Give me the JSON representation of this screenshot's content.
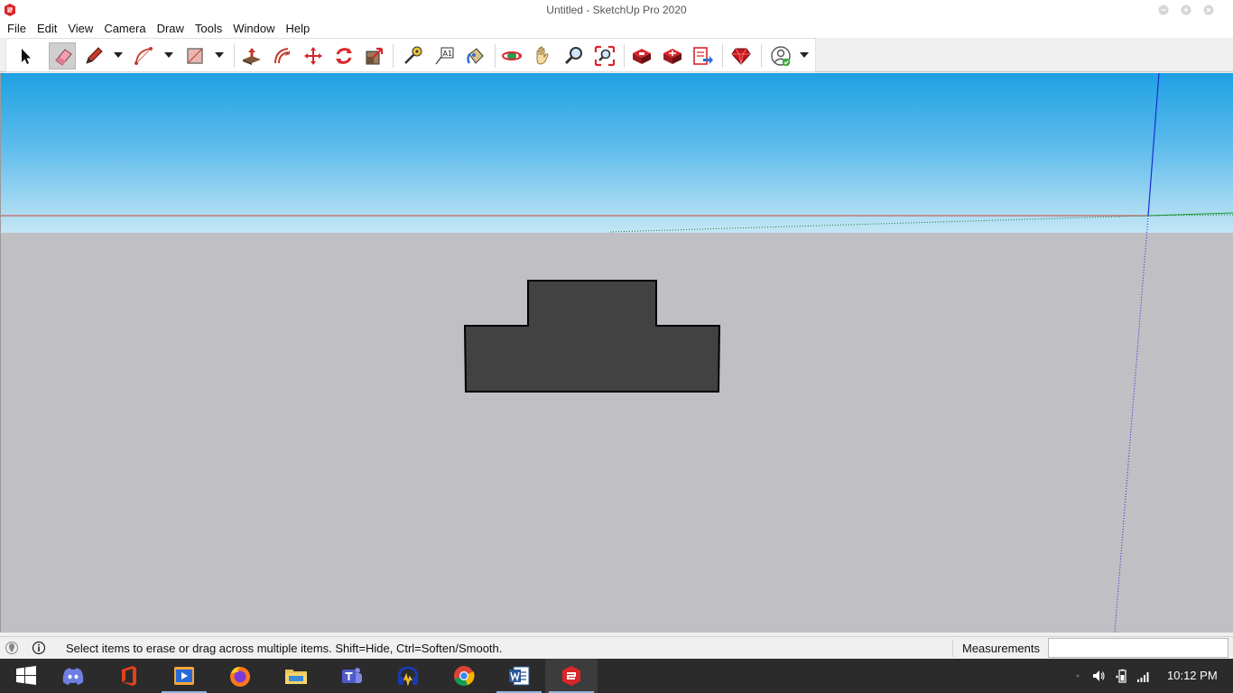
{
  "window": {
    "title": "Untitled - SketchUp Pro 2020",
    "app_icon": "sketchup-icon",
    "controls": [
      "minimize-icon",
      "maximize-icon",
      "close-icon"
    ]
  },
  "menu": [
    {
      "id": "file",
      "label": "File"
    },
    {
      "id": "edit",
      "label": "Edit"
    },
    {
      "id": "view",
      "label": "View"
    },
    {
      "id": "camera",
      "label": "Camera"
    },
    {
      "id": "draw",
      "label": "Draw"
    },
    {
      "id": "tools",
      "label": "Tools"
    },
    {
      "id": "window",
      "label": "Window"
    },
    {
      "id": "help",
      "label": "Help"
    }
  ],
  "toolbar": {
    "tools": [
      {
        "id": "select",
        "icon": "select-arrow-icon"
      },
      {
        "id": "eraser",
        "icon": "eraser-icon",
        "active": true
      },
      {
        "id": "line",
        "icon": "pencil-line-icon",
        "dropdown": true
      },
      {
        "id": "arc",
        "icon": "arc-icon",
        "dropdown": true
      },
      {
        "id": "shapes",
        "icon": "rectangle-icon",
        "dropdown": true
      },
      {
        "id": "push-pull",
        "icon": "push-pull-icon"
      },
      {
        "id": "offset",
        "icon": "offset-icon"
      },
      {
        "id": "move",
        "icon": "move-icon"
      },
      {
        "id": "rotate",
        "icon": "rotate-icon"
      },
      {
        "id": "scale",
        "icon": "scale-icon"
      },
      {
        "id": "tape-measure",
        "icon": "tape-measure-icon"
      },
      {
        "id": "text",
        "icon": "text-icon"
      },
      {
        "id": "paint-bucket",
        "icon": "paint-bucket-icon"
      },
      {
        "id": "orbit",
        "icon": "orbit-icon"
      },
      {
        "id": "pan",
        "icon": "pan-hand-icon"
      },
      {
        "id": "zoom",
        "icon": "zoom-icon"
      },
      {
        "id": "zoom-extents",
        "icon": "zoom-extents-icon"
      },
      {
        "id": "3d-warehouse",
        "icon": "3d-warehouse-icon"
      },
      {
        "id": "extension-warehouse",
        "icon": "extension-warehouse-icon"
      },
      {
        "id": "send-to-layout",
        "icon": "send-to-layout-icon"
      },
      {
        "id": "extension-manager",
        "icon": "ruby-gem-icon"
      },
      {
        "id": "account",
        "icon": "account-user-icon",
        "dropdown": true
      }
    ]
  },
  "status": {
    "message": "Select items to erase or drag across multiple items. Shift=Hide, Ctrl=Soften/Smooth.",
    "icons": [
      "geo-location-icon",
      "info-icon"
    ],
    "measurements_label": "Measurements",
    "measurements_value": ""
  },
  "taskbar": {
    "apps": [
      {
        "id": "start",
        "icon": "windows-start-icon"
      },
      {
        "id": "discord",
        "icon": "discord-icon"
      },
      {
        "id": "office",
        "icon": "office-icon"
      },
      {
        "id": "video",
        "icon": "video-player-icon",
        "running": true
      },
      {
        "id": "firefox",
        "icon": "firefox-icon"
      },
      {
        "id": "explorer",
        "icon": "file-explorer-icon"
      },
      {
        "id": "teams",
        "icon": "teams-icon"
      },
      {
        "id": "audio",
        "icon": "headphones-icon"
      },
      {
        "id": "chrome",
        "icon": "chrome-icon"
      },
      {
        "id": "word",
        "icon": "word-icon",
        "running": true
      },
      {
        "id": "sketchup",
        "icon": "sketchup-icon",
        "running": true,
        "active": true
      }
    ],
    "tray": [
      "chevron-up-icon",
      "volume-icon",
      "battery-icon",
      "network-icon"
    ],
    "clock": "10:12 PM"
  },
  "colors": {
    "accent_red": "#d9262b",
    "shape_fill": "#424242",
    "axis_red": "#d04040",
    "axis_green": "#1c9a2c",
    "axis_blue": "#1a2cd8",
    "sky_top": "#1fa0e2",
    "ground": "#bfbfc4"
  }
}
